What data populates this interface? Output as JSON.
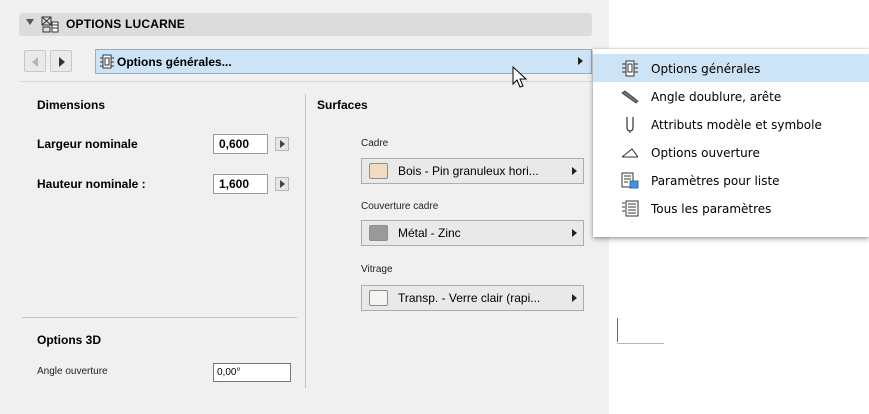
{
  "panel": {
    "title": "OPTIONS LUCARNE",
    "page_select_label": "Options générales..."
  },
  "dimensions": {
    "title": "Dimensions",
    "width_label": "Largeur nominale",
    "width_value": "0,600",
    "height_label": "Hauteur nominale :",
    "height_value": "1,600"
  },
  "surfaces": {
    "title": "Surfaces",
    "frame_label": "Cadre",
    "frame_material": "Bois - Pin granuleux hori...",
    "frame_color": "#f2dcc0",
    "cover_label": "Couverture cadre",
    "cover_material": "Métal - Zinc",
    "cover_color": "#9a9a9a",
    "glazing_label": "Vitrage",
    "glazing_material": "Transp. - Verre clair (rapi...",
    "glazing_color": "#f4f4f0"
  },
  "options3d": {
    "title": "Options 3D",
    "opening_angle_label": "Angle ouverture",
    "opening_angle_value": "0,00°"
  },
  "menu": {
    "items": [
      {
        "label": "Options générales",
        "icon": "general-options-icon"
      },
      {
        "label": "Angle doublure, arête",
        "icon": "edge-angle-icon"
      },
      {
        "label": "Attributs modèle et symbole",
        "icon": "model-attributes-icon"
      },
      {
        "label": "Options ouverture",
        "icon": "opening-options-icon"
      },
      {
        "label": "Paramètres pour liste",
        "icon": "list-parameters-icon"
      },
      {
        "label": "Tous les paramètres",
        "icon": "all-parameters-icon"
      }
    ],
    "selected_index": 0
  },
  "colors": {
    "selection": "#cde4f7",
    "selection_border": "#7eb4ea",
    "panel_bg": "#f0f0f0"
  }
}
